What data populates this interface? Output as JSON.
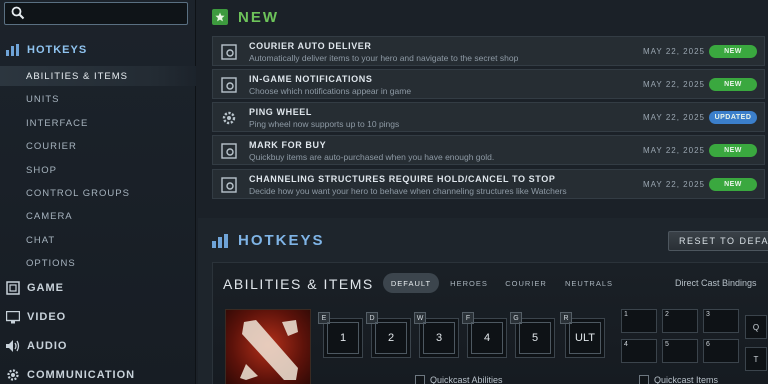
{
  "sidebar": {
    "search_value": "",
    "sections": [
      {
        "label": "HOTKEYS",
        "icon": "bars-icon"
      },
      {
        "label": "GAME",
        "icon": "game-icon"
      },
      {
        "label": "VIDEO",
        "icon": "monitor-icon"
      },
      {
        "label": "AUDIO",
        "icon": "speaker-icon"
      },
      {
        "label": "COMMUNICATION",
        "icon": "gear-icon"
      }
    ],
    "items": [
      "ABILITIES & ITEMS",
      "UNITS",
      "INTERFACE",
      "COURIER",
      "SHOP",
      "CONTROL GROUPS",
      "CAMERA",
      "CHAT",
      "OPTIONS"
    ],
    "active_item": "ABILITIES & ITEMS"
  },
  "new_section": {
    "title": "NEW",
    "rows": [
      {
        "title": "COURIER AUTO DELIVER",
        "desc": "Automatically deliver items to your hero and navigate to the secret shop",
        "date": "MAY 22, 2025",
        "badge": "NEW",
        "icon": "settings-window-icon"
      },
      {
        "title": "IN-GAME NOTIFICATIONS",
        "desc": "Choose which notifications appear in game",
        "date": "MAY 22, 2025",
        "badge": "NEW",
        "icon": "settings-window-icon"
      },
      {
        "title": "PING WHEEL",
        "desc": "Ping wheel now supports up to 10 pings",
        "date": "MAY 22, 2025",
        "badge": "UPDATED",
        "icon": "gear-icon"
      },
      {
        "title": "MARK FOR BUY",
        "desc": "Quickbuy items are auto-purchased when you have enough gold.",
        "date": "MAY 22, 2025",
        "badge": "NEW",
        "icon": "settings-window-icon"
      },
      {
        "title": "CHANNELING STRUCTURES REQUIRE HOLD/CANCEL TO STOP",
        "desc": "Decide how you want your hero to behave when channeling structures like Watchers",
        "date": "MAY 22, 2025",
        "badge": "NEW",
        "icon": "settings-window-icon"
      }
    ]
  },
  "hotkeys": {
    "title": "HOTKEYS",
    "reset_label": "RESET TO DEFAULT",
    "panel_title": "ABILITIES & ITEMS",
    "tabs": [
      "DEFAULT",
      "HEROES",
      "COURIER",
      "NEUTRALS"
    ],
    "active_tab": "DEFAULT",
    "direct_cast": "Direct Cast Bindings",
    "ability_slots": [
      {
        "key": "E",
        "label": "1"
      },
      {
        "key": "D",
        "label": "2"
      },
      {
        "key": "W",
        "label": "3"
      },
      {
        "key": "F",
        "label": "4"
      },
      {
        "key": "G",
        "label": "5"
      },
      {
        "key": "R",
        "label": "ULT"
      }
    ],
    "item_slots": [
      "1",
      "2",
      "3",
      "4",
      "5",
      "6"
    ],
    "side_slots": [
      "Q",
      "T"
    ],
    "quickcast_abilities": "Quickcast Abilities",
    "quickcast_items": "Quickcast Items"
  },
  "colors": {
    "new_badge": "#3aa83f",
    "updated_badge": "#3b7fcb",
    "accent_green": "#6dc35a",
    "accent_blue": "#7fb4e6"
  }
}
